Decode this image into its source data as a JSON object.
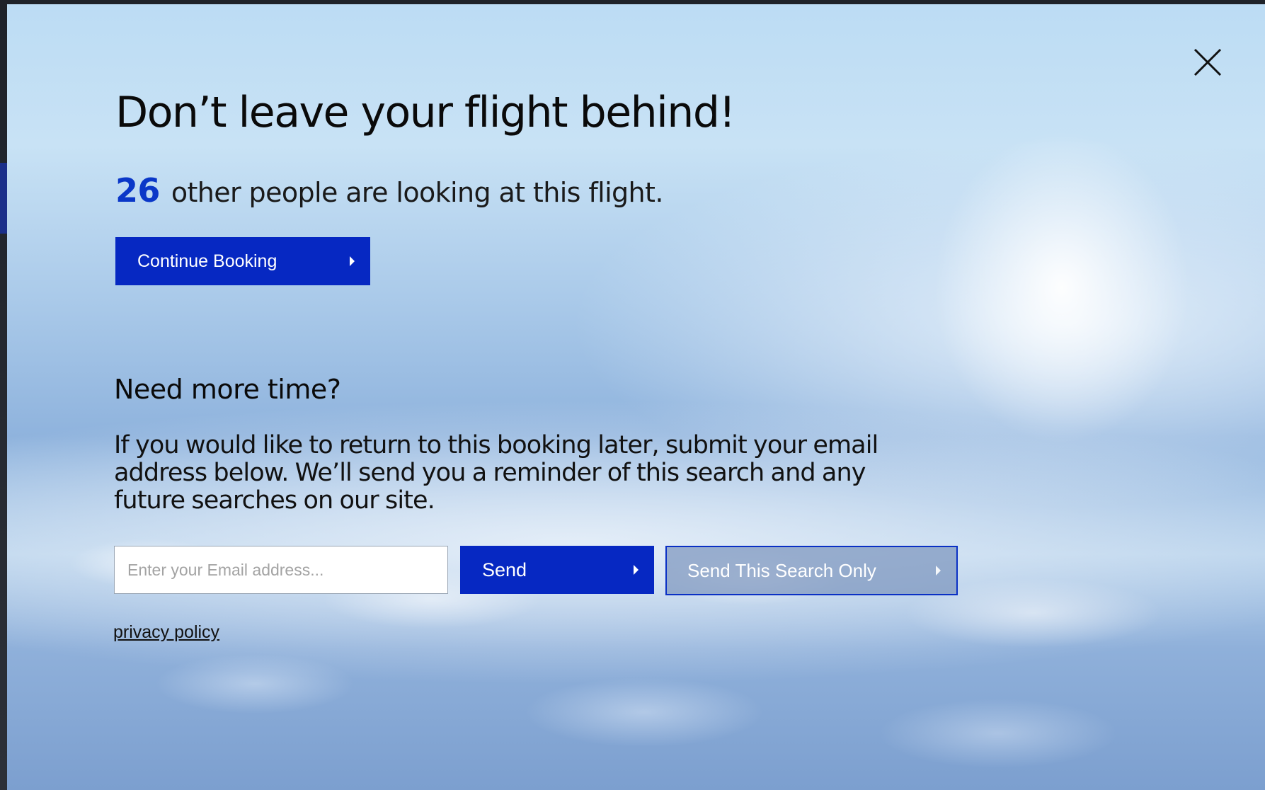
{
  "modal": {
    "close_icon": "close-icon",
    "headline": "Don’t leave your flight behind!",
    "viewers": {
      "count": "26",
      "text": "other people are looking at this flight."
    },
    "continue_button": {
      "label": "Continue Booking",
      "icon": "play-arrow-icon"
    },
    "section_title": "Need more time?",
    "description": "If you would like to return to this booking later, submit your email address below. We’ll send you a reminder of this search and any future searches on our site.",
    "email_field": {
      "value": "",
      "placeholder": "Enter your Email address..."
    },
    "send_button": {
      "label": "Send",
      "icon": "play-arrow-icon"
    },
    "send_search_only_button": {
      "label": "Send This Search Only",
      "icon": "play-arrow-icon"
    },
    "privacy_link": "privacy policy"
  },
  "colors": {
    "accent": "#0628c2",
    "count_text": "#0a37c8",
    "headline_text": "#0a0a0a"
  }
}
